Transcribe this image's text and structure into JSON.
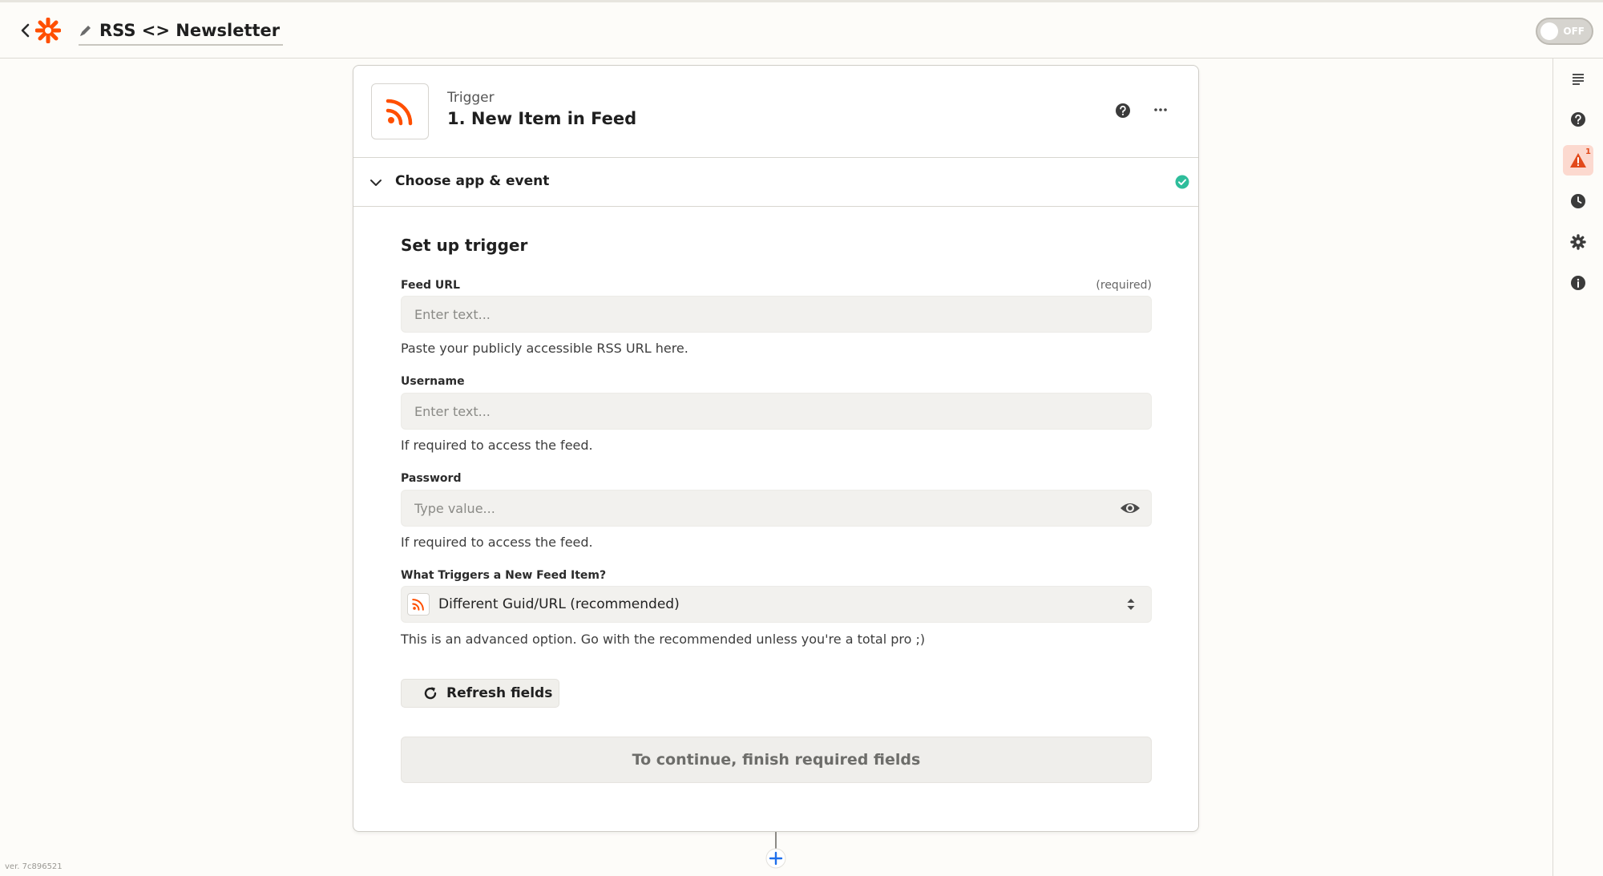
{
  "header": {
    "title": "RSS <> Newsletter",
    "toggle_label": "OFF"
  },
  "step": {
    "kicker": "Trigger",
    "title": "1. New Item in Feed"
  },
  "section": {
    "label": "Choose app & event"
  },
  "form": {
    "title": "Set up trigger",
    "feed_url": {
      "label": "Feed URL",
      "required": "(required)",
      "placeholder": "Enter text...",
      "help": "Paste your publicly accessible RSS URL here."
    },
    "username": {
      "label": "Username",
      "placeholder": "Enter text...",
      "help": "If required to access the feed."
    },
    "password": {
      "label": "Password",
      "placeholder": "Type value...",
      "help": "If required to access the feed."
    },
    "trigger_type": {
      "label": "What Triggers a New Feed Item?",
      "selected": "Different Guid/URL (recommended)",
      "help": "This is an advanced option. Go with the recommended unless you're a total pro ;)"
    },
    "refresh_label": "Refresh fields",
    "continue_label": "To continue, finish required fields"
  },
  "sidebar": {
    "alert_count": "1"
  },
  "footer": {
    "version": "ver. 7c896521"
  },
  "colors": {
    "brand": "#ff4f00",
    "success": "#2ebd9b",
    "add": "#1f6feb"
  }
}
